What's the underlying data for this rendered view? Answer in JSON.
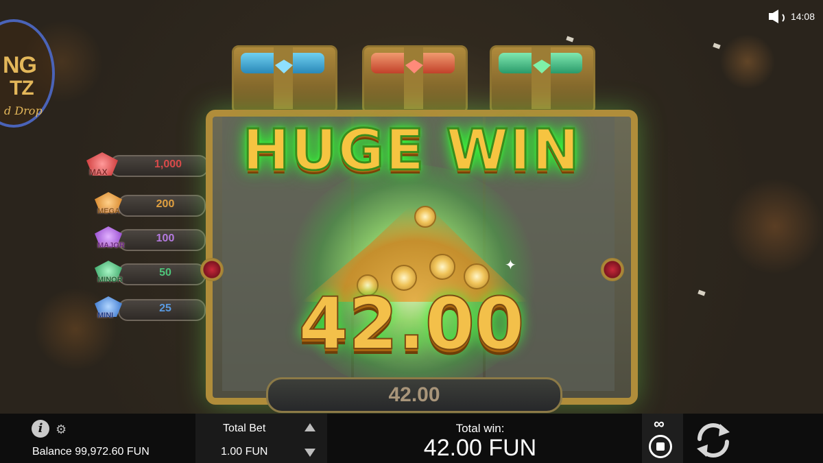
{
  "status": {
    "time": "14:08"
  },
  "logo": {
    "line1": "NG",
    "line2": "TZ",
    "line3": "d Drop"
  },
  "jackpots": [
    {
      "label": "MAX",
      "value": "1,000",
      "color": "#d83a3a"
    },
    {
      "label": "MEGA",
      "value": "200",
      "color": "#e08a2a"
    },
    {
      "label": "MAJOR",
      "value": "100",
      "color": "#9b4bd6"
    },
    {
      "label": "MINOR",
      "value": "50",
      "color": "#2fb36a"
    },
    {
      "label": "MINI",
      "value": "25",
      "color": "#3a84d8"
    }
  ],
  "win_overlay": {
    "title": "HUGE WIN",
    "amount": "42.00",
    "strip_amount": "42.00"
  },
  "bottom_bar": {
    "balance": "Balance 99,972.60 FUN",
    "total_bet_label": "Total Bet",
    "total_bet_value": "1.00 FUN",
    "total_win_label": "Total win:",
    "total_win_value": "42.00 FUN",
    "autoplay_symbol": "∞"
  },
  "icons": {
    "volume": "speaker-icon",
    "info": "info-icon",
    "settings": "gear-icon",
    "bet_up": "triangle-up-icon",
    "bet_down": "triangle-down-icon",
    "autoplay": "autoplay-stop-icon",
    "spin": "spin-arrows-icon"
  },
  "colors": {
    "gold_text": "#f3c04a",
    "win_glow": "#3ff53c",
    "chest_blue": "#3aa6d8",
    "chest_red": "#d84a3a",
    "chest_green": "#2fb36a"
  }
}
